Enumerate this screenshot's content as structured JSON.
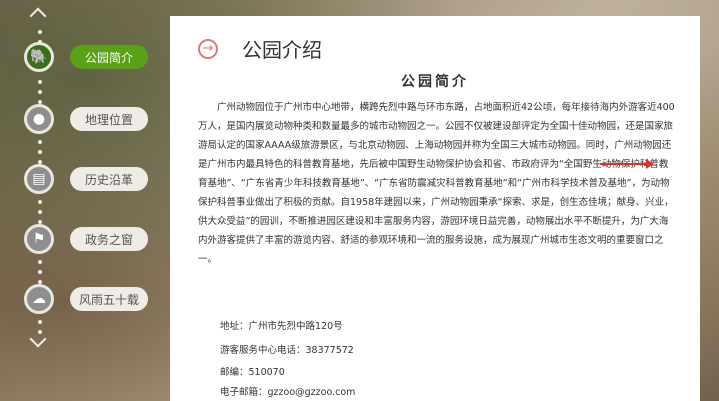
{
  "nav": {
    "items": [
      {
        "label": "公园简介",
        "icon": "elephant-icon",
        "active": true
      },
      {
        "label": "地理位置",
        "icon": "location-pin-icon",
        "active": false
      },
      {
        "label": "历史沿革",
        "icon": "book-icon",
        "active": false
      },
      {
        "label": "政务之窗",
        "icon": "flag-icon",
        "active": false
      },
      {
        "label": "风雨五十载",
        "icon": "cloud-icon",
        "active": false
      }
    ]
  },
  "main": {
    "title": "公园介绍",
    "section_title": "公园简介",
    "paragraph": "广州动物园位于广州市中心地带，横跨先烈中路与环市东路，占地面积近42公顷，每年接待海内外游客近400万人，是国内展览动物种类和数量最多的城市动物园之一。公园不仅被建设部评定为全国十佳动物园，还是国家旅游局认定的国家AAAA级旅游景区，与北京动物园、上海动物园并称为全国三大城市动物园。同时，广州动物园还是广州市内最具特色的科普教育基地，先后被中国野生动物保护协会和省、市政府评为“全国野生动物保护科普教育基地”、“广东省青少年科技教育基地”、“广东省防震减灾科普教育基地”和“广州市科学技术普及基地”，为动物保护科普事业做出了积极的贡献。自1958年建园以来，广州动物园秉承“探索、求是，创生态佳境；献身、兴业，供大众受益”的园训，不断推进园区建设和丰富服务内容，游园环境日益完善，动物展出水平不断提升，为广大海内外游客提供了丰富的游览内容、舒适的参观环境和一流的服务设施，成为展现广州城市生态文明的重要窗口之一。",
    "address": "地址：广州市先烈中路120号",
    "phone": "游客服务中心电话：38377572",
    "postcode": "邮编：510070",
    "email": "电子邮箱：gzzoo@gzzoo.com"
  },
  "colors": {
    "active_green": "#5aa117",
    "accent_red": "#e03030"
  }
}
